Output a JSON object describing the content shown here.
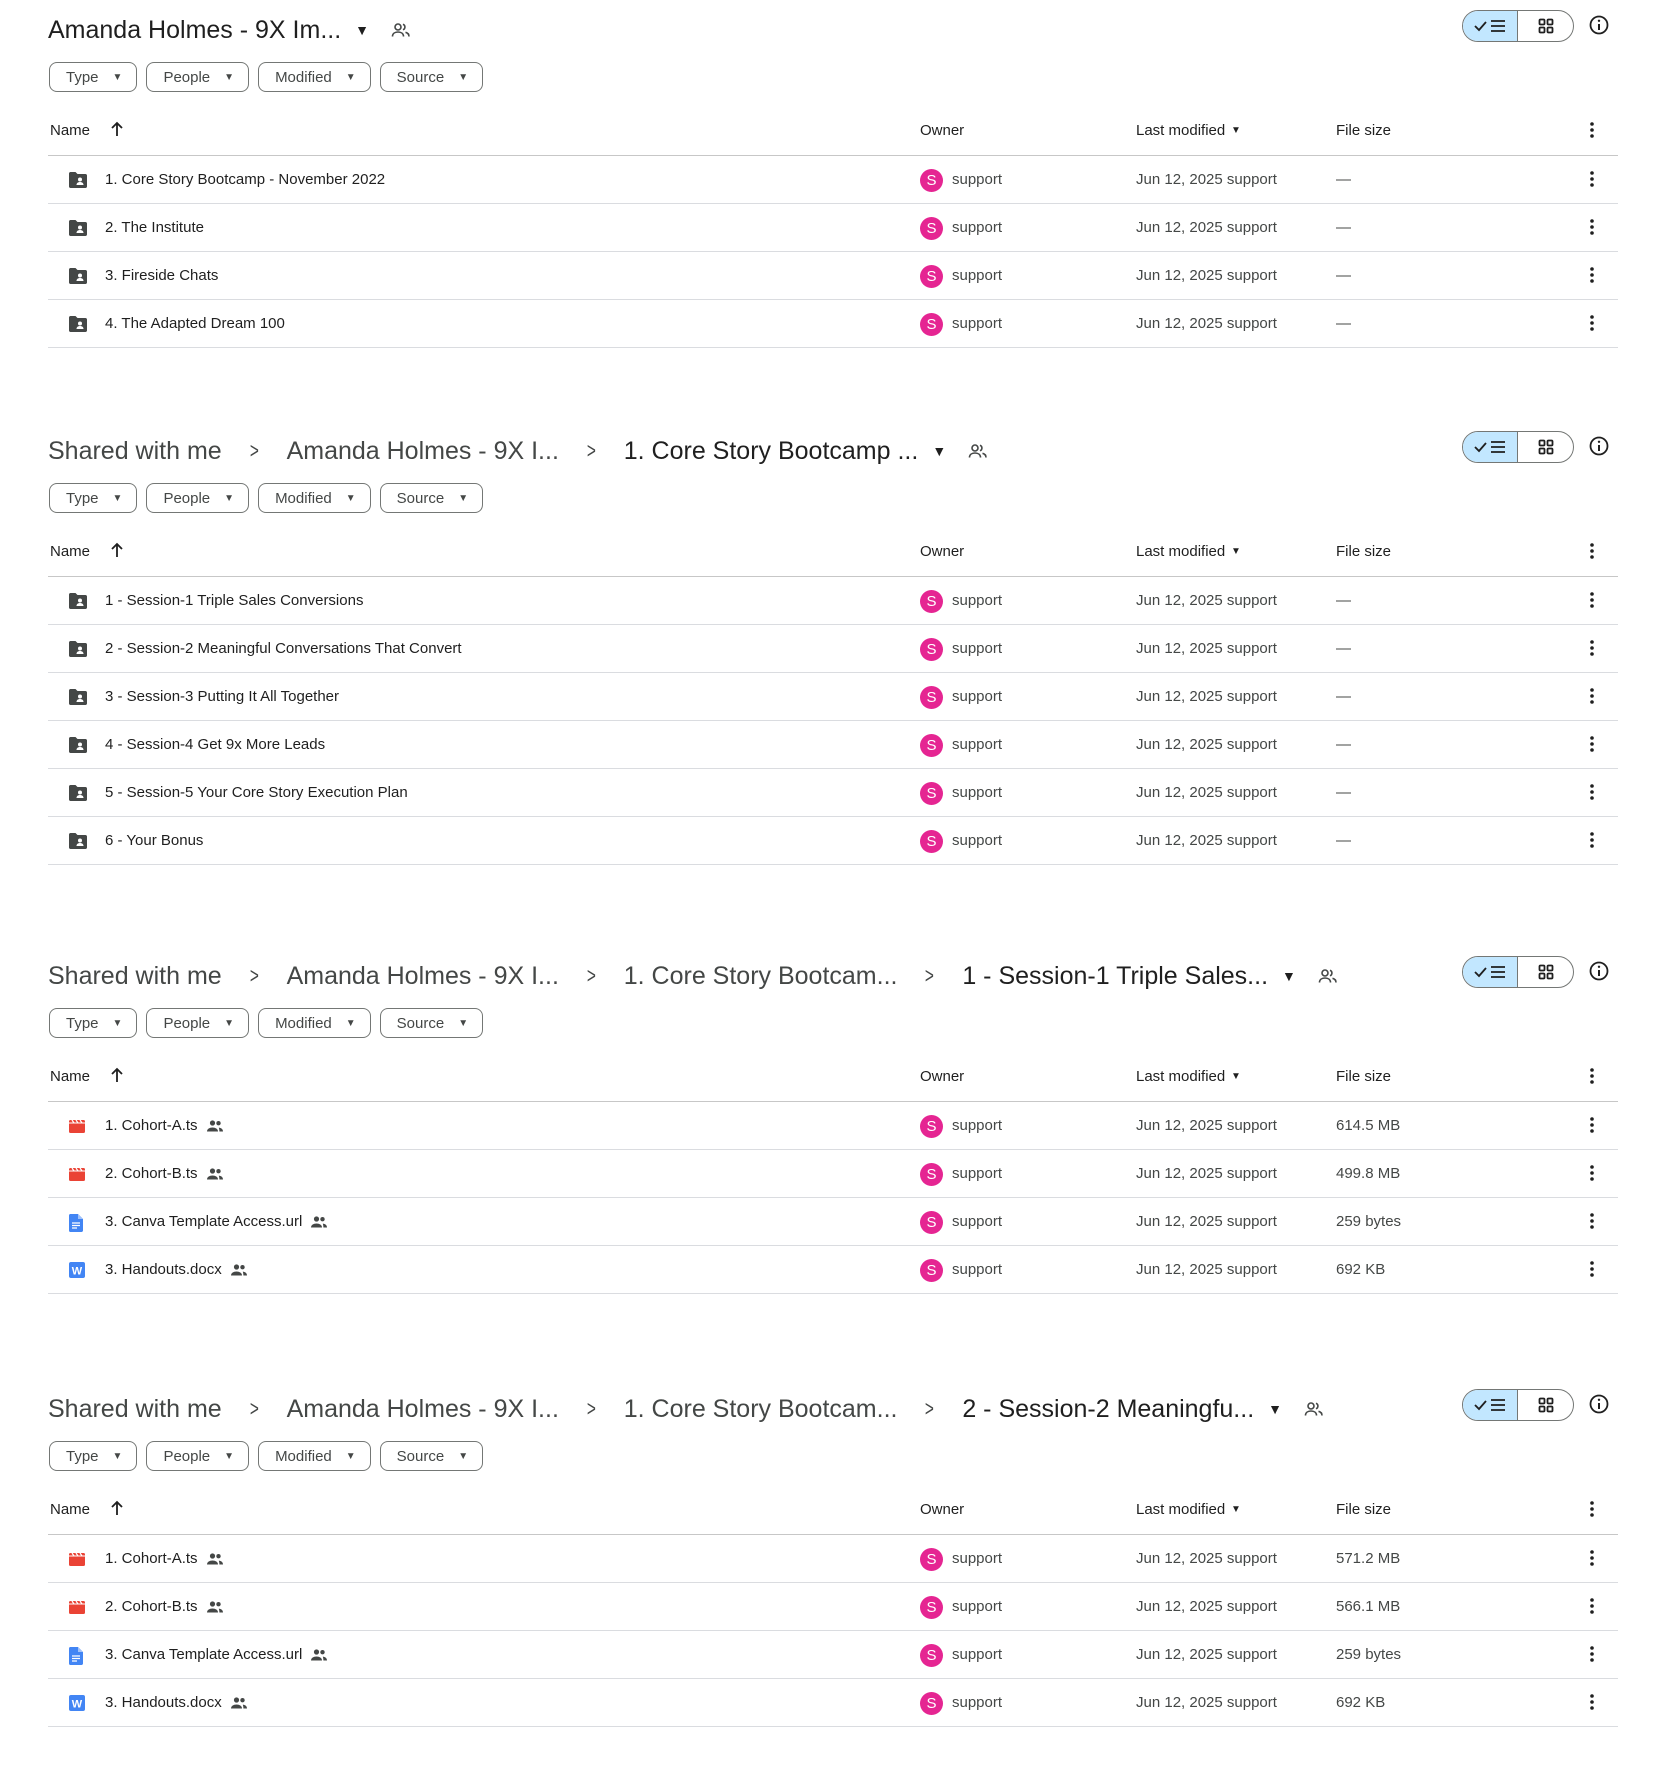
{
  "columns": {
    "name": "Name",
    "owner": "Owner",
    "modified": "Last modified",
    "size": "File size"
  },
  "filters": [
    "Type",
    "People",
    "Modified",
    "Source"
  ],
  "colors": {
    "avatar": "#e52592",
    "video": "#ea4335",
    "doc": "#4285f4",
    "word": "#4285f4",
    "folder": "#444746"
  },
  "panels": [
    {
      "crumbs": [
        "Amanda Holmes - 9X Im..."
      ],
      "rows": [
        {
          "icon": "shared-folder-icon",
          "name": "1. Core Story Bootcamp - November 2022",
          "shared": false,
          "owner": "support",
          "avatar": "S",
          "modified": "Jun 12, 2025 support",
          "size": "—"
        },
        {
          "icon": "shared-folder-icon",
          "name": "2. The Institute",
          "shared": false,
          "owner": "support",
          "avatar": "S",
          "modified": "Jun 12, 2025 support",
          "size": "—"
        },
        {
          "icon": "shared-folder-icon",
          "name": "3. Fireside Chats",
          "shared": false,
          "owner": "support",
          "avatar": "S",
          "modified": "Jun 12, 2025 support",
          "size": "—"
        },
        {
          "icon": "shared-folder-icon",
          "name": "4. The Adapted Dream 100",
          "shared": false,
          "owner": "support",
          "avatar": "S",
          "modified": "Jun 12, 2025 support",
          "size": "—"
        }
      ]
    },
    {
      "crumbs": [
        "Shared with me",
        "Amanda Holmes - 9X I...",
        "1. Core Story Bootcamp ..."
      ],
      "rows": [
        {
          "icon": "shared-folder-icon",
          "name": "1 - Session-1 Triple Sales Conversions",
          "shared": false,
          "owner": "support",
          "avatar": "S",
          "modified": "Jun 12, 2025 support",
          "size": "—"
        },
        {
          "icon": "shared-folder-icon",
          "name": "2 - Session-2 Meaningful Conversations That Convert",
          "shared": false,
          "owner": "support",
          "avatar": "S",
          "modified": "Jun 12, 2025 support",
          "size": "—"
        },
        {
          "icon": "shared-folder-icon",
          "name": "3 - Session-3 Putting It All Together",
          "shared": false,
          "owner": "support",
          "avatar": "S",
          "modified": "Jun 12, 2025 support",
          "size": "—"
        },
        {
          "icon": "shared-folder-icon",
          "name": "4 - Session-4 Get 9x More Leads",
          "shared": false,
          "owner": "support",
          "avatar": "S",
          "modified": "Jun 12, 2025 support",
          "size": "—"
        },
        {
          "icon": "shared-folder-icon",
          "name": "5 - Session-5 Your Core Story Execution Plan",
          "shared": false,
          "owner": "support",
          "avatar": "S",
          "modified": "Jun 12, 2025 support",
          "size": "—"
        },
        {
          "icon": "shared-folder-icon",
          "name": "6 - Your Bonus",
          "shared": false,
          "owner": "support",
          "avatar": "S",
          "modified": "Jun 12, 2025 support",
          "size": "—"
        }
      ]
    },
    {
      "crumbs": [
        "Shared with me",
        "Amanda Holmes - 9X I...",
        "1. Core Story Bootcam...",
        "1 - Session-1 Triple Sales..."
      ],
      "rows": [
        {
          "icon": "video-file-icon",
          "name": "1. Cohort-A.ts",
          "shared": true,
          "owner": "support",
          "avatar": "S",
          "modified": "Jun 12, 2025 support",
          "size": "614.5 MB"
        },
        {
          "icon": "video-file-icon",
          "name": "2. Cohort-B.ts",
          "shared": true,
          "owner": "support",
          "avatar": "S",
          "modified": "Jun 12, 2025 support",
          "size": "499.8 MB"
        },
        {
          "icon": "doc-file-icon",
          "name": "3. Canva Template Access.url",
          "shared": true,
          "owner": "support",
          "avatar": "S",
          "modified": "Jun 12, 2025 support",
          "size": "259 bytes"
        },
        {
          "icon": "word-file-icon",
          "name": "3. Handouts.docx",
          "shared": true,
          "owner": "support",
          "avatar": "S",
          "modified": "Jun 12, 2025 support",
          "size": "692 KB"
        }
      ]
    },
    {
      "crumbs": [
        "Shared with me",
        "Amanda Holmes - 9X I...",
        "1. Core Story Bootcam...",
        "2 - Session-2 Meaningfu..."
      ],
      "rows": [
        {
          "icon": "video-file-icon",
          "name": "1. Cohort-A.ts",
          "shared": true,
          "owner": "support",
          "avatar": "S",
          "modified": "Jun 12, 2025 support",
          "size": "571.2 MB"
        },
        {
          "icon": "video-file-icon",
          "name": "2. Cohort-B.ts",
          "shared": true,
          "owner": "support",
          "avatar": "S",
          "modified": "Jun 12, 2025 support",
          "size": "566.1 MB"
        },
        {
          "icon": "doc-file-icon",
          "name": "3. Canva Template Access.url",
          "shared": true,
          "owner": "support",
          "avatar": "S",
          "modified": "Jun 12, 2025 support",
          "size": "259 bytes"
        },
        {
          "icon": "word-file-icon",
          "name": "3. Handouts.docx",
          "shared": true,
          "owner": "support",
          "avatar": "S",
          "modified": "Jun 12, 2025 support",
          "size": "692 KB"
        }
      ]
    }
  ]
}
